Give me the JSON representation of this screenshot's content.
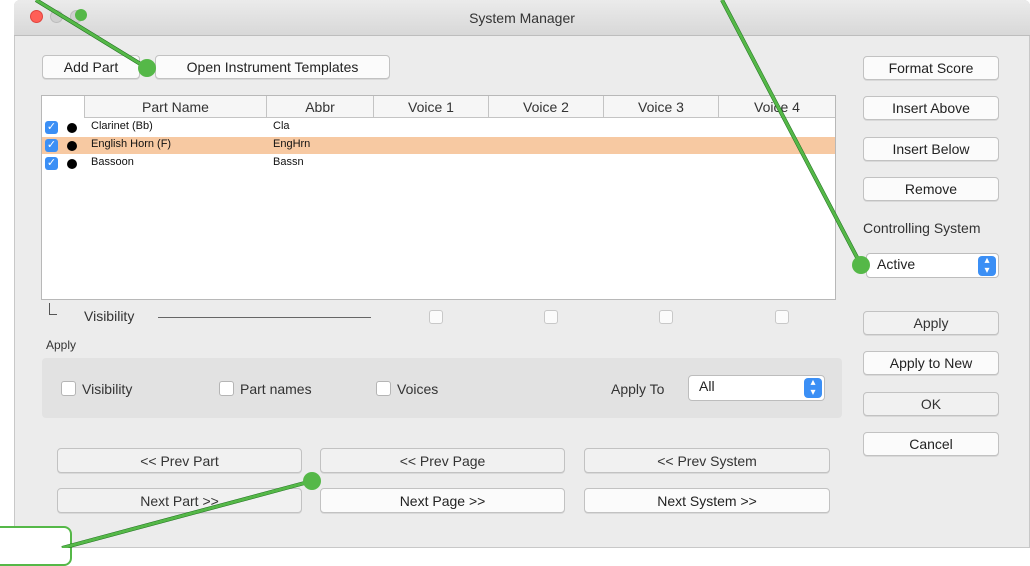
{
  "window": {
    "title": "System Manager"
  },
  "toolbar": {
    "add_part": "Add Part",
    "open_templates": "Open Instrument Templates"
  },
  "table": {
    "columns": [
      "Part Name",
      "Abbr",
      "Voice 1",
      "Voice 2",
      "Voice 3",
      "Voice 4"
    ],
    "rows": [
      {
        "name": "Clarinet (Bb)",
        "abbr": "Cla",
        "checked": true,
        "selected": false
      },
      {
        "name": "English Horn (F)",
        "abbr": "EngHrn",
        "checked": true,
        "selected": true
      },
      {
        "name": "Bassoon",
        "abbr": "Bassn",
        "checked": true,
        "selected": false
      }
    ],
    "selected_color": "#f7c9a2"
  },
  "visibility": {
    "label": "Visibility"
  },
  "apply_section": {
    "title": "Apply",
    "visibility": "Visibility",
    "part_names": "Part names",
    "voices": "Voices",
    "apply_to_label": "Apply To",
    "apply_to_value": "All"
  },
  "nav": {
    "prev_part": "<< Prev Part",
    "prev_page": "<< Prev Page",
    "prev_system": "<< Prev System",
    "next_part": "Next Part >>",
    "next_page": "Next Page >>",
    "next_system": "Next System >>"
  },
  "side": {
    "format_score": "Format Score",
    "insert_above": "Insert Above",
    "insert_below": "Insert Below",
    "remove": "Remove",
    "controlling_system_label": "Controlling System",
    "controlling_system_value": "Active",
    "apply": "Apply",
    "apply_to_new": "Apply to New",
    "ok": "OK",
    "cancel": "Cancel"
  },
  "colors": {
    "accent": "#3b8ff5",
    "annotation": "#55b848",
    "close": "#ff5f57"
  },
  "icons": [
    "checkmark-icon",
    "dot-icon",
    "chevron-updown-icon",
    "corner-bracket-icon"
  ]
}
